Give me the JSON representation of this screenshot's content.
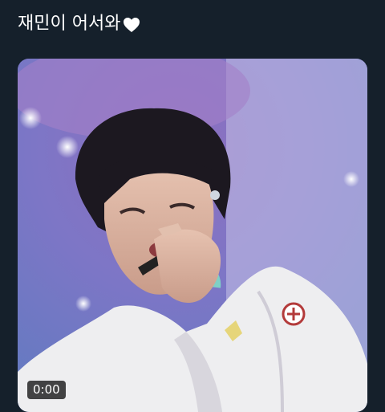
{
  "tweet": {
    "text": "재민이 어서와",
    "emoji": "white-heart-icon"
  },
  "media": {
    "type": "video",
    "duration_label": "0:00"
  }
}
